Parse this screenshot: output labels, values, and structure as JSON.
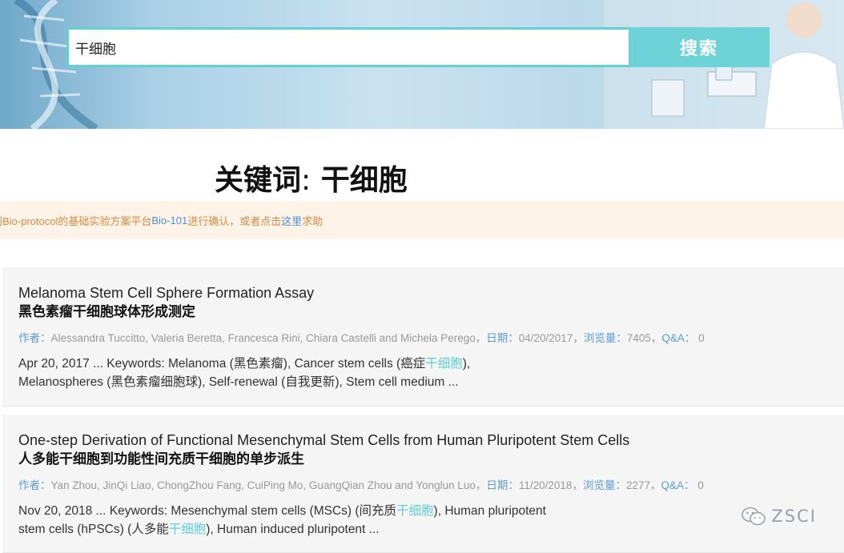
{
  "search": {
    "value": "干细胞",
    "button_label": "搜索"
  },
  "keyword_title": {
    "label": "关键词",
    "separator": ":",
    "term": "干细胞"
  },
  "notice": {
    "prefix": "到Bio-protocol的基础实验方案平台",
    "link_platform": "Bio-101",
    "middle": "进行确认，或者点击",
    "link_here": "这里",
    "suffix": "求助"
  },
  "results": [
    {
      "title_en": "Melanoma Stem Cell Sphere Formation Assay",
      "title_cn": "黑色素瘤干细胞球体形成测定",
      "author_label": "作者：",
      "authors": "Alessandra Tuccitto, Valeria Beretta, Francesca Rini, Chiara Castelli and Michela Perego，",
      "date_label": "日期：",
      "date": "04/20/2017，",
      "views_label": "浏览量：",
      "views": "7405，",
      "qa_label": "Q&A：",
      "qa": " 0",
      "snippet_line1_a": "Apr 20, 2017 ... Keywords: Melanoma (黑色素瘤), Cancer stem cells (癌症",
      "snippet_line1_hl": "干细胞",
      "snippet_line1_b": "),",
      "snippet_line2": "Melanospheres (黑色素瘤细胞球), Self-renewal (自我更新), Stem cell medium ..."
    },
    {
      "title_en": "One-step Derivation of Functional Mesenchymal Stem Cells from Human Pluripotent Stem Cells",
      "title_cn": "人多能干细胞到功能性间充质干细胞的单步派生",
      "author_label": "作者：",
      "authors": "Yan Zhou, JinQi Liao, ChongZhou Fang, CuiPing Mo, GuangQian Zhou and Yonglun Luo，",
      "date_label": "日期：",
      "date": "11/20/2018，",
      "views_label": "浏览量：",
      "views": "2277，",
      "qa_label": "Q&A：",
      "qa": " 0",
      "snippet_line1_a": "Nov 20, 2018 ... Keywords: Mesenchymal stem cells (MSCs) (间充质",
      "snippet_line1_hl": "干细胞",
      "snippet_line1_b": "), Human pluripotent",
      "snippet_line2_a": "stem cells (hPSCs) (人多能",
      "snippet_line2_hl": "干细胞",
      "snippet_line2_b": "), Human induced pluripotent ..."
    }
  ],
  "watermark": {
    "text": "ZSCI",
    "icon": "wechat-icon"
  },
  "colors": {
    "accent": "#6ed3d6",
    "highlight": "#5fcfd3",
    "link": "#5b9bd5",
    "notice_text": "#d98a4a",
    "notice_bg": "#fdf3e7"
  }
}
